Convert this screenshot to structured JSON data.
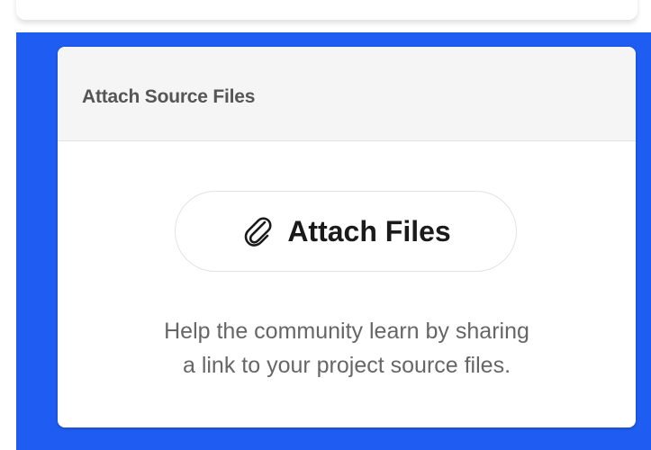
{
  "card": {
    "title": "Attach Source Files",
    "attach_button": {
      "label": "Attach Files",
      "icon": "paperclip-icon"
    },
    "help_text": {
      "line1": "Help the community learn by sharing",
      "line2": "a link to your project source files."
    }
  },
  "colors": {
    "highlight": "#1f5cf2",
    "header_bg": "#f5f5f5",
    "title": "#555555",
    "button_text": "#1a1a1a",
    "help_text": "#666666"
  }
}
